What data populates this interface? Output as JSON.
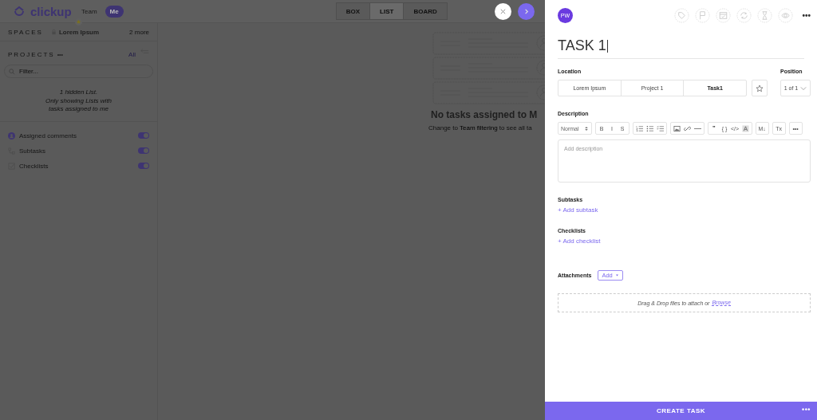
{
  "app": {
    "logo": "clickup",
    "filter_tabs": [
      {
        "label": "Team",
        "selected": false
      },
      {
        "label": "Me",
        "selected": true
      }
    ],
    "view_tabs": [
      {
        "label": "BOX",
        "selected": false
      },
      {
        "label": "LIST",
        "selected": true
      },
      {
        "label": "BOARD",
        "selected": false
      }
    ],
    "sidebar": {
      "spaces_label": "SPACES",
      "space": "Lorem Ipsum",
      "more": "2 more",
      "projects_label": "PROJECTS",
      "projects_menu": "•••",
      "all": "All",
      "filter": {
        "placeholder": "Filter..."
      },
      "hidden_title": "1 hidden List.",
      "hidden_note": "Only showing Lists with tasks assigned to me",
      "toggles": [
        {
          "kind": "person",
          "label": "Assigned comments",
          "on": true
        },
        {
          "kind": "subtasks",
          "label": "Subtasks",
          "on": true
        },
        {
          "kind": "checklist",
          "label": "Checklists",
          "on": true
        }
      ]
    },
    "empty_state": {
      "title": "No tasks assigned to M",
      "hint_before": "Change to",
      "hint_link": "Team filtering",
      "hint_after": "to see all ta"
    }
  },
  "task": {
    "avatar": "PW",
    "more": "•••",
    "title": "TASK 1",
    "location_label": "Location",
    "breadcrumbs": [
      {
        "label": "Lorem Ipsum",
        "selected": false
      },
      {
        "label": "Project 1",
        "selected": false
      },
      {
        "label": "Task1",
        "selected": true
      }
    ],
    "position_label": "Position",
    "position": "1 of 1",
    "description_label": "Description",
    "editor_toolbar": {
      "format": "Normal",
      "groups": [
        [
          {
            "kind": "glyph",
            "text": "B"
          },
          {
            "kind": "glyph",
            "text": "I"
          },
          {
            "kind": "glyph",
            "text": "S"
          }
        ],
        [
          {
            "kind": "ordered-list"
          },
          {
            "kind": "bullet-list"
          },
          {
            "kind": "check-list"
          }
        ],
        [
          {
            "kind": "image"
          },
          {
            "kind": "link"
          },
          {
            "kind": "rule"
          }
        ],
        [
          {
            "kind": "glyph",
            "text": "❞"
          },
          {
            "kind": "glyph",
            "text": "{ }"
          },
          {
            "kind": "glyph",
            "text": "</>"
          },
          {
            "kind": "text-color"
          }
        ],
        [
          {
            "kind": "glyph",
            "text": "M↓"
          }
        ],
        [
          {
            "kind": "glyph",
            "text": "Tx"
          }
        ],
        [
          {
            "kind": "glyph",
            "text": "•••"
          }
        ]
      ]
    },
    "description": {
      "placeholder": "Add description"
    },
    "subtasks_label": "Subtasks",
    "add_subtask": "+ Add subtask",
    "checklists_label": "Checklists",
    "add_checklist": "+ Add checklist",
    "attachments_label": "Attachments",
    "add_attachment": "Add",
    "drop_text": "Drag & Drop files to attach or",
    "browse": "Browse",
    "create": "CREATE TASK",
    "footer_more": "•••"
  }
}
